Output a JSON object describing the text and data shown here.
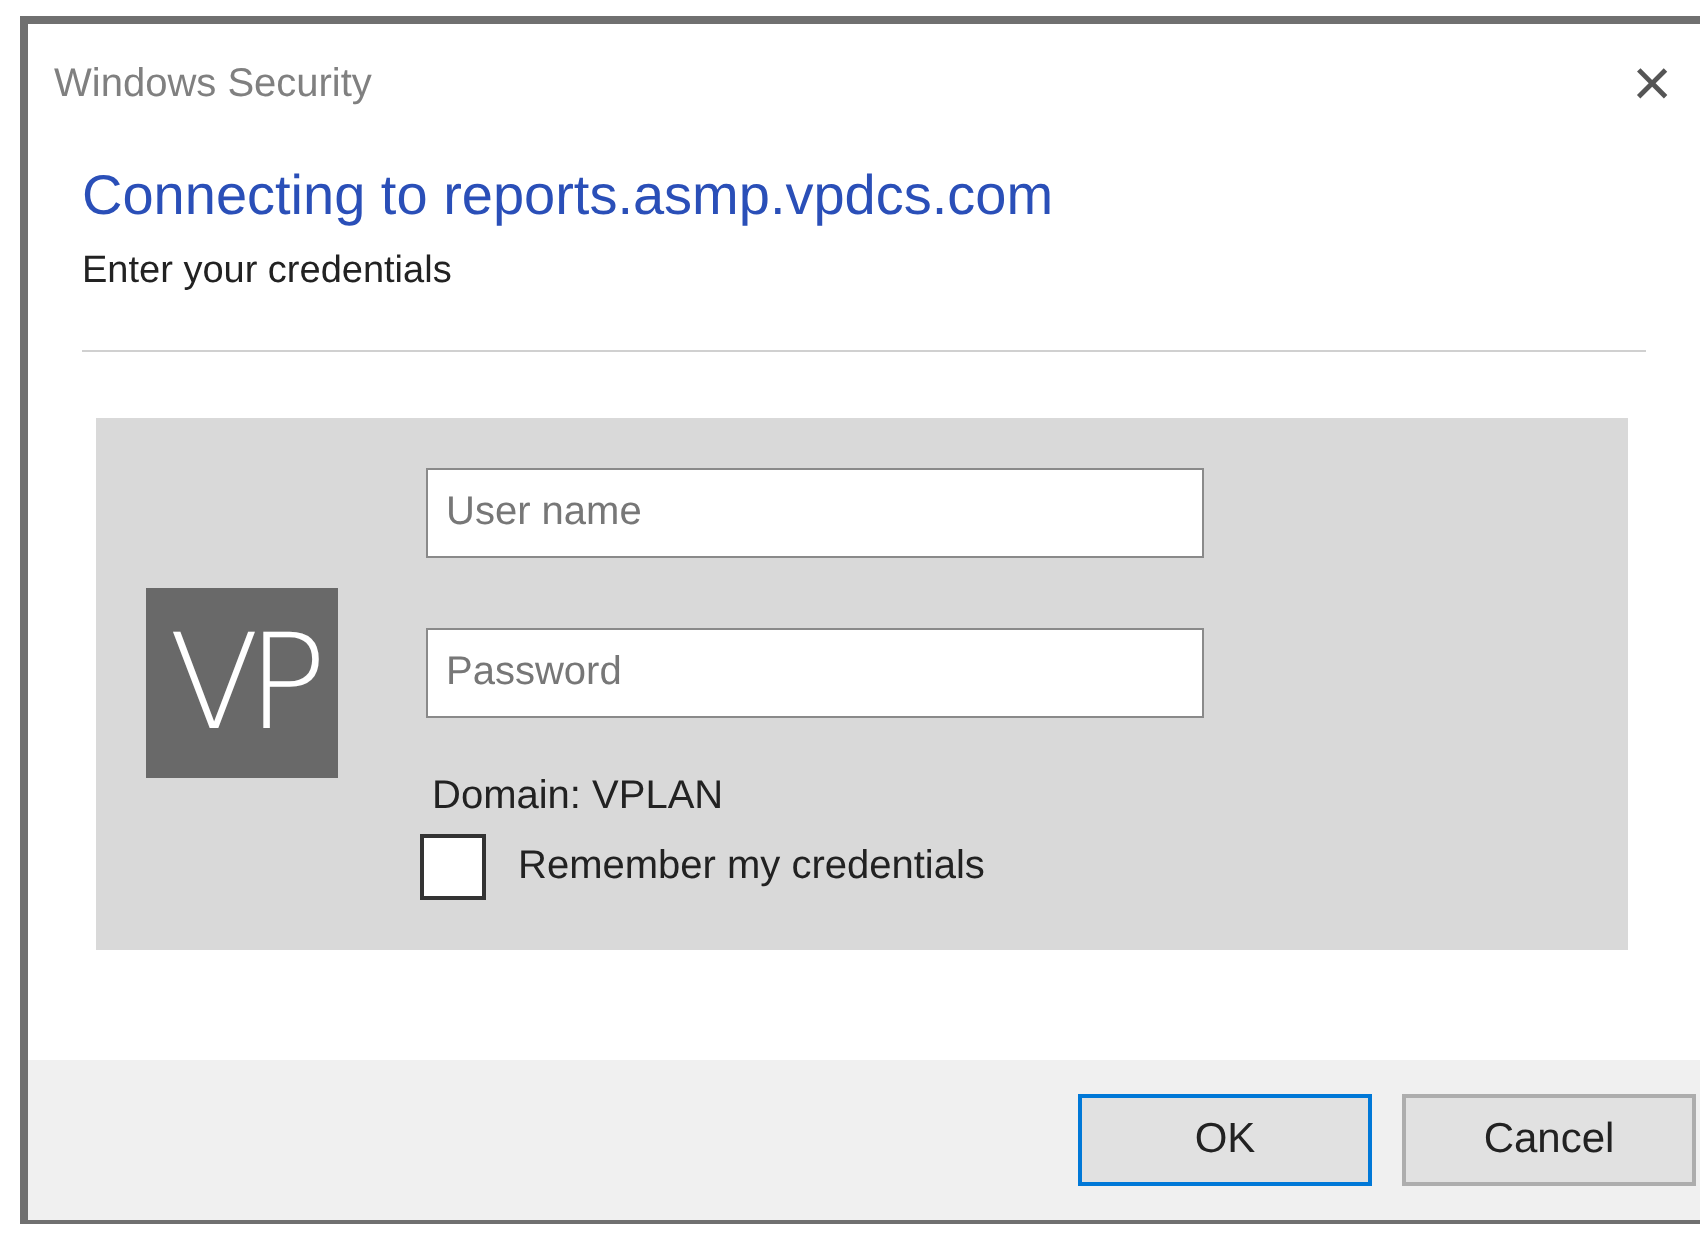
{
  "window": {
    "title": "Windows Security",
    "close": "×"
  },
  "heading": "Connecting to reports.asmp.vpdcs.com",
  "subtitle": "Enter your credentials",
  "logo": {
    "text": "VP"
  },
  "fields": [
    {
      "placeholder": "User name"
    },
    {
      "placeholder": "Password"
    }
  ],
  "domain": "Domain: VPLAN",
  "remember": {
    "label": "Remember my credentials",
    "checked": false
  },
  "buttons": [
    {
      "label": "OK",
      "default": true
    },
    {
      "label": "Cancel",
      "default": false
    }
  ]
}
